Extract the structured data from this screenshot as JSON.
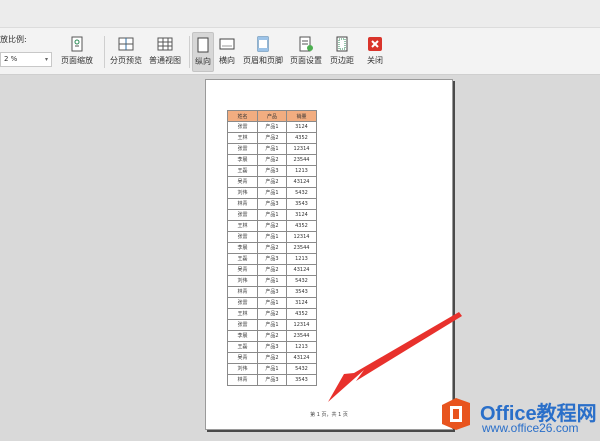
{
  "toolbar": {
    "zoom_label": "放比例:",
    "zoom_value": "2 %",
    "buttons": [
      {
        "label": "页面缩放",
        "icon": "page-zoom-icon"
      },
      {
        "label": "分页预览",
        "icon": "page-break-preview-icon"
      },
      {
        "label": "普通视图",
        "icon": "normal-view-icon"
      },
      {
        "label": "纵向",
        "icon": "portrait-icon",
        "active": true
      },
      {
        "label": "横向",
        "icon": "landscape-icon"
      },
      {
        "label": "页眉和页脚",
        "icon": "header-footer-icon"
      },
      {
        "label": "页面设置",
        "icon": "page-setup-icon"
      },
      {
        "label": "页边距",
        "icon": "margins-icon"
      },
      {
        "label": "关闭",
        "icon": "close-icon"
      }
    ]
  },
  "sheet": {
    "headers": [
      "姓名",
      "产品",
      "销量"
    ],
    "header_color": "#f2ad80",
    "rows": [
      [
        "张雷",
        "产品1",
        "3124"
      ],
      [
        "王林",
        "产品2",
        "4352"
      ],
      [
        "张雷",
        "产品1",
        "12314"
      ],
      [
        "李晨",
        "产品2",
        "23544"
      ],
      [
        "王磊",
        "产品3",
        "1213"
      ],
      [
        "吴青",
        "产品2",
        "43124"
      ],
      [
        "刘伟",
        "产品1",
        "5432"
      ],
      [
        "林青",
        "产品3",
        "3543"
      ],
      [
        "张雷",
        "产品1",
        "3124"
      ],
      [
        "王林",
        "产品2",
        "4352"
      ],
      [
        "张雷",
        "产品1",
        "12314"
      ],
      [
        "李晨",
        "产品2",
        "23544"
      ],
      [
        "王磊",
        "产品3",
        "1213"
      ],
      [
        "吴青",
        "产品2",
        "43124"
      ],
      [
        "刘伟",
        "产品1",
        "5432"
      ],
      [
        "林青",
        "产品3",
        "3543"
      ],
      [
        "张雷",
        "产品1",
        "3124"
      ],
      [
        "王林",
        "产品2",
        "4352"
      ],
      [
        "张雷",
        "产品1",
        "12314"
      ],
      [
        "李晨",
        "产品2",
        "23544"
      ],
      [
        "王磊",
        "产品3",
        "1213"
      ],
      [
        "吴青",
        "产品2",
        "43124"
      ],
      [
        "刘伟",
        "产品1",
        "5432"
      ],
      [
        "林青",
        "产品3",
        "3543"
      ]
    ]
  },
  "page_footer": "第 1 页，共 1 页",
  "annotation_arrow_color": "#e8312c",
  "watermark": {
    "title": "Office教程网",
    "url": "www.office26.com",
    "brand_color": "#2a6fc9",
    "logo_color": "#e8541e"
  }
}
